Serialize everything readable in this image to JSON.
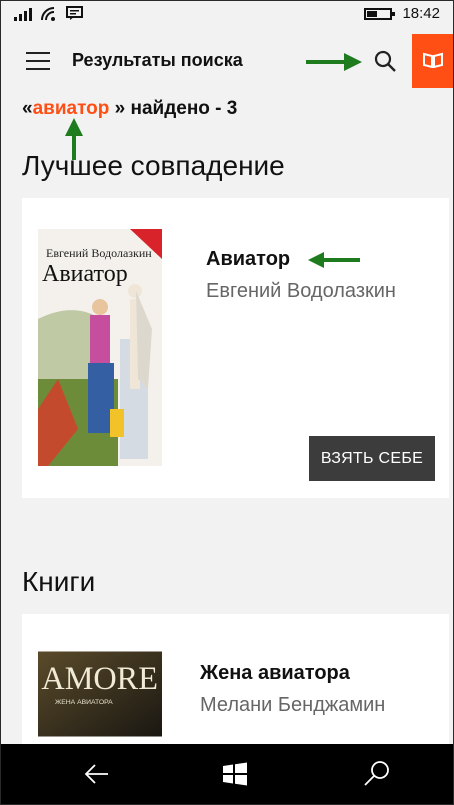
{
  "status": {
    "time": "18:42"
  },
  "header": {
    "title": "Результаты поиска"
  },
  "query": {
    "open_quote": "«",
    "term": "авиатор",
    "rest": " » найдено - 3"
  },
  "best_match": {
    "heading": "Лучшее совпадение",
    "book": {
      "title": "Авиатор",
      "author": "Евгений Водолазкин",
      "cover_author": "Евгений Водолазкин",
      "cover_title": "Авиатор",
      "action_label": "ВЗЯТЬ СЕБЕ"
    }
  },
  "books": {
    "heading": "Книги",
    "items": [
      {
        "title": "Жена авиатора",
        "author": "Мелани Бенджамин",
        "cover_title": "AMORE",
        "cover_subtitle": "ЖЕНА АВИАТОРА"
      }
    ]
  },
  "colors": {
    "accent": "#ff4f14",
    "arrow": "#1e7b1e",
    "button": "#3c3c3c"
  },
  "icons": {
    "menu": "hamburger-icon",
    "search": "search-icon",
    "reader": "open-book-icon",
    "nav_back": "back-arrow-icon",
    "nav_home": "windows-logo-icon",
    "nav_search": "search-icon"
  }
}
